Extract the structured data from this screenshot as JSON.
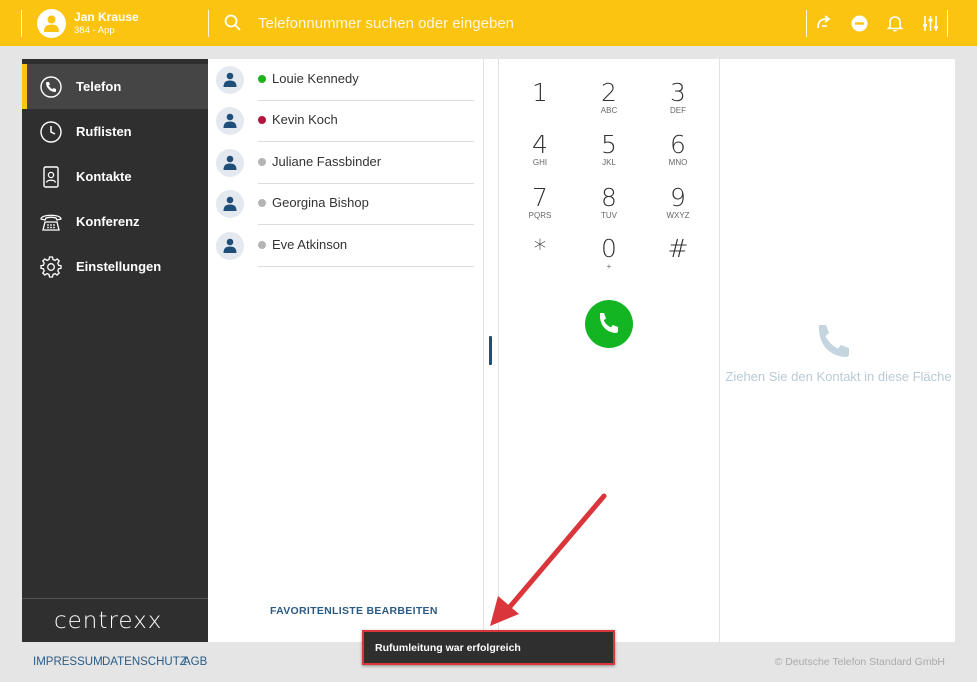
{
  "header": {
    "user_name": "Jan Krause",
    "user_extension": "384 - App",
    "search_placeholder": "Telefonnummer suchen oder eingeben",
    "accent_color": "#fbc410",
    "icons": [
      "call-forward-icon",
      "do-not-disturb-icon",
      "bell-icon",
      "sliders-icon"
    ]
  },
  "sidebar": {
    "items": [
      {
        "label": "Telefon",
        "icon": "phone-icon",
        "active": true
      },
      {
        "label": "Ruflisten",
        "icon": "clock-icon"
      },
      {
        "label": "Kontakte",
        "icon": "contact-card-icon"
      },
      {
        "label": "Konferenz",
        "icon": "conference-phone-icon"
      },
      {
        "label": "Einstellungen",
        "icon": "gear-icon"
      }
    ],
    "logo": "centrexx"
  },
  "favorites": {
    "contacts": [
      {
        "name": "Louie Kennedy",
        "status": "online",
        "status_color": "#1db31d"
      },
      {
        "name": "Kevin Koch",
        "status": "busy",
        "status_color": "#b3173d"
      },
      {
        "name": "Juliane Fassbinder",
        "status": "offline",
        "status_color": "#b4b4b4"
      },
      {
        "name": "Georgina Bishop",
        "status": "offline",
        "status_color": "#b4b4b4"
      },
      {
        "name": "Eve Atkinson",
        "status": "offline",
        "status_color": "#b4b4b4"
      }
    ],
    "edit_label": "FAVORITENLISTE BEARBEITEN"
  },
  "dialpad": {
    "keys": [
      {
        "digit": "1",
        "letters": ""
      },
      {
        "digit": "2",
        "letters": "ABC"
      },
      {
        "digit": "3",
        "letters": "DEF"
      },
      {
        "digit": "4",
        "letters": "GHI"
      },
      {
        "digit": "5",
        "letters": "JKL"
      },
      {
        "digit": "6",
        "letters": "MNO"
      },
      {
        "digit": "7",
        "letters": "PQRS"
      },
      {
        "digit": "8",
        "letters": "TUV"
      },
      {
        "digit": "9",
        "letters": "WXYZ"
      },
      {
        "digit": "*",
        "letters": ""
      },
      {
        "digit": "0",
        "letters": "+"
      },
      {
        "digit": "#",
        "letters": ""
      }
    ],
    "call_color": "#13b523"
  },
  "dropzone": {
    "text": "Ziehen Sie den Kontakt in diese Fläche"
  },
  "footer": {
    "links": [
      "IMPRESSUM",
      "DATENSCHUTZ",
      "AGB"
    ],
    "copyright": "© Deutsche Telefon Standard GmbH"
  },
  "toast": {
    "message": "Rufumleitung war erfolgreich",
    "highlight_color": "#d9353a"
  }
}
